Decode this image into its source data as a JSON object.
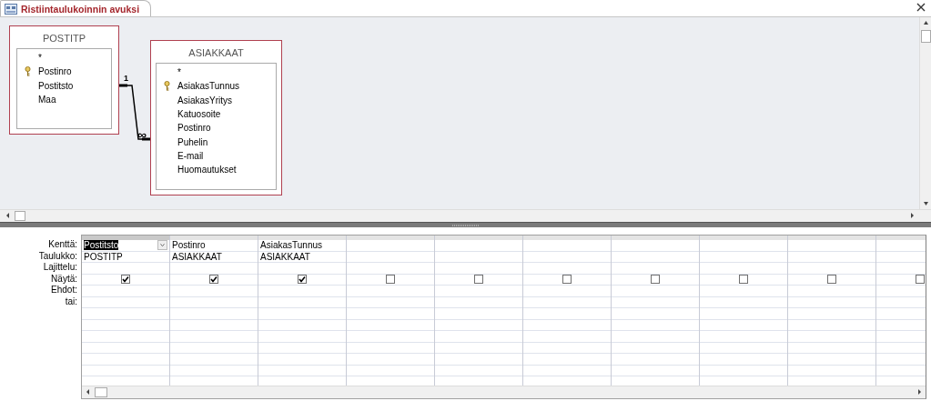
{
  "tabs": [
    {
      "label": "Ristiintaulukoinnin avuksi",
      "selected": true
    }
  ],
  "tables": [
    {
      "name": "POSTITP",
      "fields": [
        {
          "name": "*",
          "primary_key": false
        },
        {
          "name": "Postinro",
          "primary_key": true
        },
        {
          "name": "Postitsto",
          "primary_key": false
        },
        {
          "name": "Maa",
          "primary_key": false
        }
      ]
    },
    {
      "name": "ASIAKKAAT",
      "fields": [
        {
          "name": "*",
          "primary_key": false
        },
        {
          "name": "AsiakasTunnus",
          "primary_key": true
        },
        {
          "name": "AsiakasYritys",
          "primary_key": false
        },
        {
          "name": "Katuosoite",
          "primary_key": false
        },
        {
          "name": "Postinro",
          "primary_key": false
        },
        {
          "name": "Puhelin",
          "primary_key": false
        },
        {
          "name": "E-mail",
          "primary_key": false
        },
        {
          "name": "Huomautukset",
          "primary_key": false
        }
      ]
    }
  ],
  "relationship": {
    "one_label": "1",
    "many_label": "∞"
  },
  "grid": {
    "rows": [
      {
        "label": "Kenttä:",
        "kind": "field"
      },
      {
        "label": "Taulukko:",
        "kind": "table"
      },
      {
        "label": "Lajittelu:",
        "kind": "sort"
      },
      {
        "label": "Näytä:",
        "kind": "show"
      },
      {
        "label": "Ehdot:",
        "kind": "criteria"
      },
      {
        "label": "tai:",
        "kind": "or"
      }
    ],
    "columns": [
      {
        "field": "Postitsto",
        "table": "POSTITP",
        "show": true,
        "selected": true
      },
      {
        "field": "Postinro",
        "table": "ASIAKKAAT",
        "show": true,
        "selected": false
      },
      {
        "field": "AsiakasTunnus",
        "table": "ASIAKKAAT",
        "show": true,
        "selected": false
      },
      {
        "show": false,
        "selected": false
      },
      {
        "show": false,
        "selected": false
      },
      {
        "show": false,
        "selected": false
      },
      {
        "show": false,
        "selected": false
      },
      {
        "show": false,
        "selected": false
      },
      {
        "show": false,
        "selected": false
      },
      {
        "show": false,
        "selected": false
      }
    ]
  }
}
